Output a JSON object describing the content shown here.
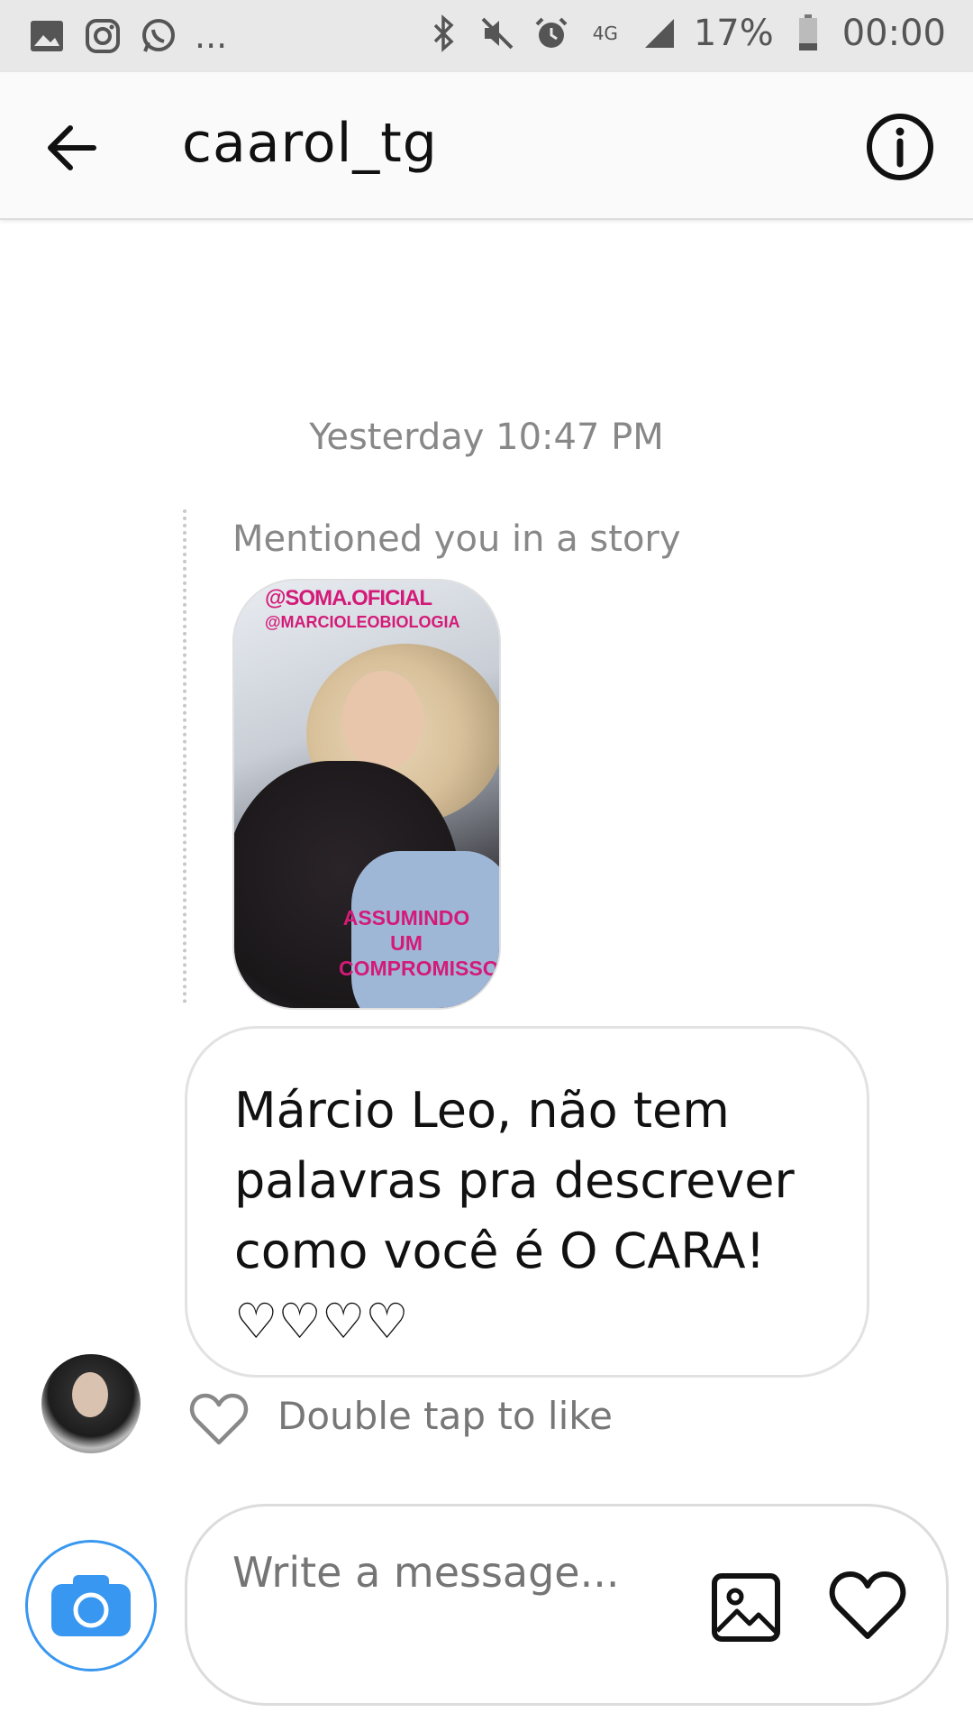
{
  "status_bar": {
    "battery": "17%",
    "time": "00:00",
    "network": "4G",
    "more": "..."
  },
  "header": {
    "title": "caarol_tg"
  },
  "conversation": {
    "timestamp": "Yesterday 10:47 PM",
    "story_mention": {
      "label": "Mentioned you in a story",
      "tag_primary": "@SOMA.OFICIAL",
      "tag_secondary": "@MARCIOLEOBIOLOGIA",
      "caption": "ASSUMINDO UM COMPROMISSO!"
    },
    "message": {
      "text": "Márcio Leo, não tem palavras pra descrever como você é O CARA! ♡♡♡♡"
    },
    "like_hint": "Double tap to like"
  },
  "composer": {
    "placeholder": "Write a message..."
  },
  "colors": {
    "accent": "#3897f0",
    "story_tag": "#d41a78"
  }
}
